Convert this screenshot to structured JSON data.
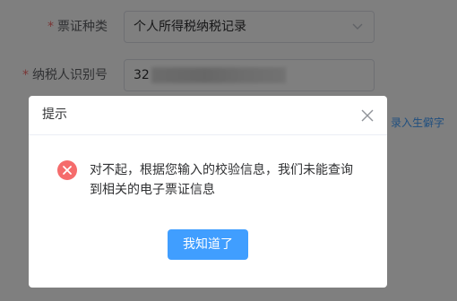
{
  "form": {
    "required_mark": "*",
    "ticket_type": {
      "label": "票证种类",
      "selected_value": "个人所得税纳税记录"
    },
    "taxpayer_id": {
      "label": "纳税人识别号",
      "value": "32"
    },
    "rare_char_link": "录入生僻字"
  },
  "dialog": {
    "title": "提示",
    "message": "对不起，根据您输入的校验信息，我们未能查询到相关的电子票证信息",
    "confirm_label": "我知道了",
    "icons": {
      "close": "close-icon",
      "error": "error-circle-icon",
      "chevron": "chevron-down-icon"
    }
  },
  "colors": {
    "primary": "#409eff",
    "error": "#f56c6c",
    "overlay": "rgba(0,0,0,0.5)"
  }
}
